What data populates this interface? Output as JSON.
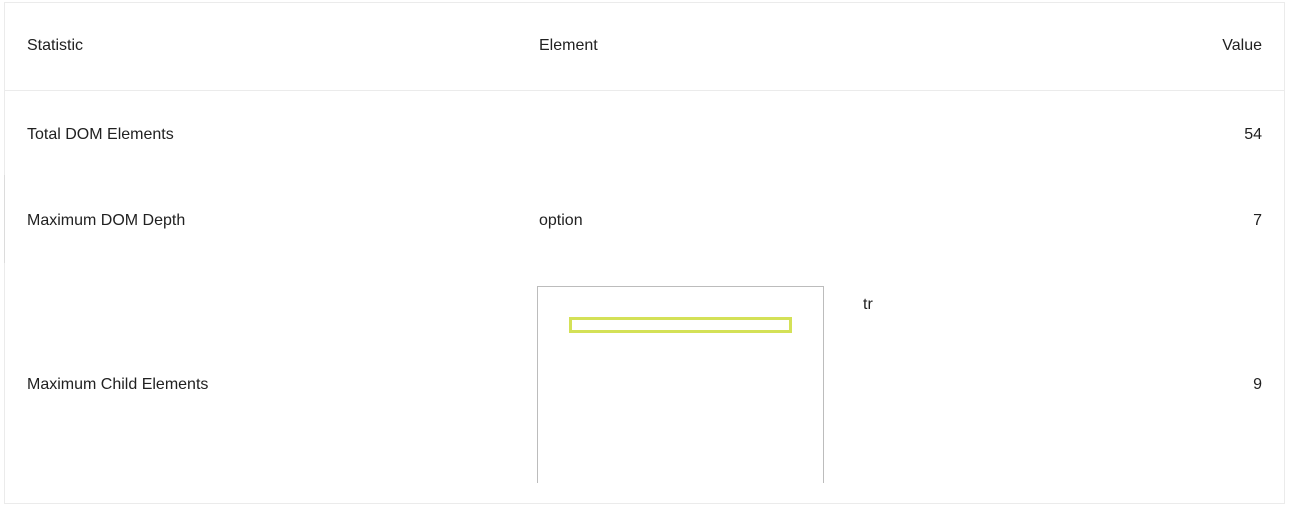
{
  "table": {
    "headers": {
      "statistic": "Statistic",
      "element": "Element",
      "value": "Value"
    },
    "rows": [
      {
        "statistic": "Total DOM Elements",
        "element": "",
        "value": "54"
      },
      {
        "statistic": "Maximum DOM Depth",
        "element": "option",
        "value": "7"
      },
      {
        "statistic": "Maximum Child Elements",
        "element": "tr",
        "value": "9"
      }
    ]
  },
  "colors": {
    "highlight": "#d4e157",
    "border": "#ebebeb",
    "text": "#212121"
  }
}
